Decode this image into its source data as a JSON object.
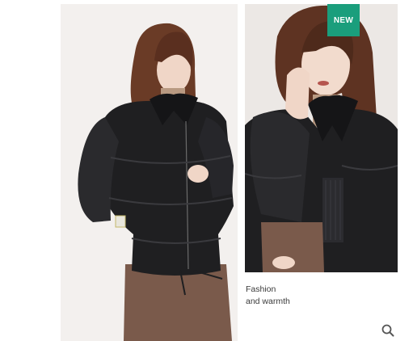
{
  "badge": {
    "label": "NEW",
    "color": "#1a9e7c"
  },
  "caption": {
    "line1": "Fashion",
    "line2": "and warmth"
  },
  "icons": {
    "zoom": "magnifier-icon"
  },
  "colors": {
    "jacket": "#1f1f21",
    "skirt": "#7a5a4b",
    "turtleneck": "#b99a82"
  }
}
